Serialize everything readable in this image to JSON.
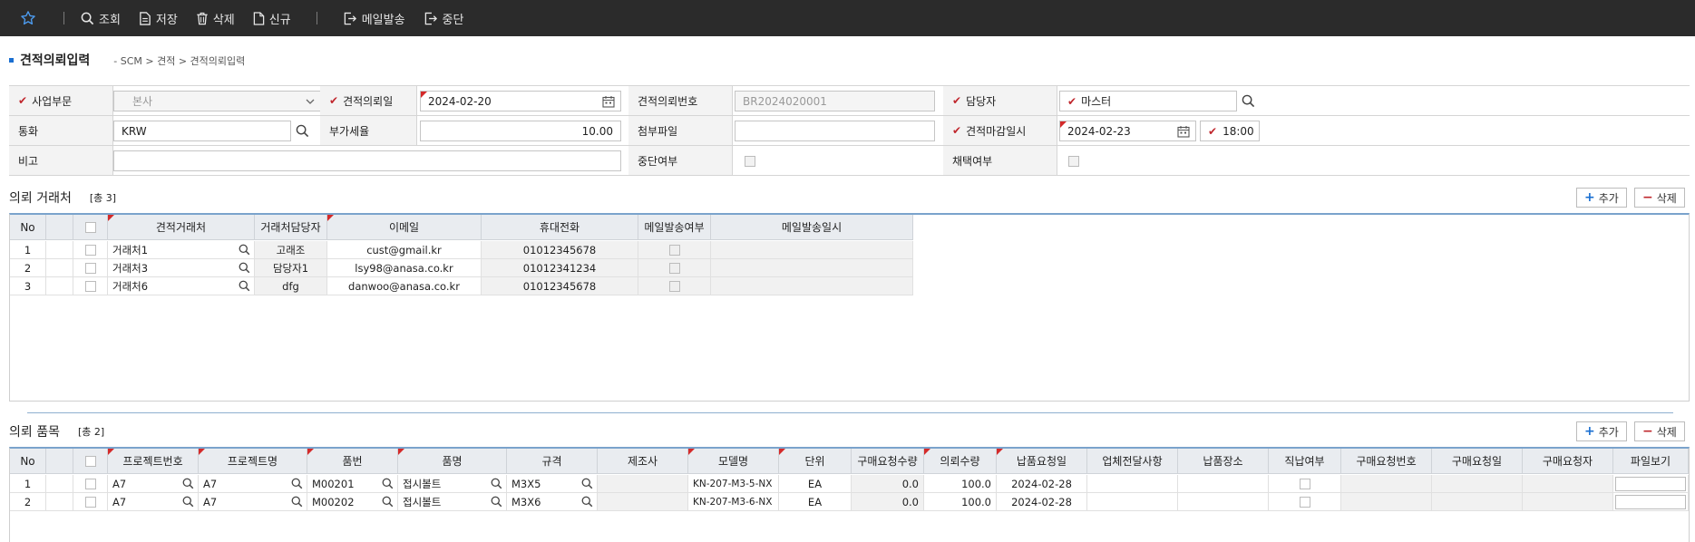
{
  "toolbar": {
    "favorite_icon": "star-icon",
    "buttons": {
      "search": "조회",
      "save": "저장",
      "delete": "삭제",
      "new": "신규",
      "send_mail": "메일발송",
      "stop": "중단"
    }
  },
  "header": {
    "title": "견적의뢰입력",
    "breadcrumb": "- SCM > 견적 > 견적의뢰입력"
  },
  "form": {
    "business_unit": {
      "label": "사업부문",
      "value": "본사"
    },
    "request_date": {
      "label": "견적의뢰일",
      "value": "2024-02-20"
    },
    "request_no": {
      "label": "견적의뢰번호",
      "value": "BR2024020001"
    },
    "manager": {
      "label": "담당자",
      "value": "마스터"
    },
    "currency": {
      "label": "통화",
      "value": "KRW"
    },
    "vat_rate": {
      "label": "부가세율",
      "value": "10.00"
    },
    "attachment": {
      "label": "첨부파일",
      "value": ""
    },
    "deadline": {
      "label": "견적마감일시",
      "date": "2024-02-23",
      "time": "18:00"
    },
    "remarks": {
      "label": "비고",
      "value": ""
    },
    "stop_flag": {
      "label": "중단여부"
    },
    "adopt_flag": {
      "label": "채택여부"
    }
  },
  "vendors": {
    "title": "의뢰 거래처",
    "count": "[총 3]",
    "add_label": "추가",
    "delete_label": "삭제",
    "columns": [
      "No",
      "견적거래처",
      "거래처담당자",
      "이메일",
      "휴대전화",
      "메일발송여부",
      "메일발송일시"
    ],
    "rows": [
      {
        "no": "1",
        "vendor": "거래처1",
        "contact": "고래조",
        "email": "cust@gmail.kr",
        "phone": "01012345678",
        "sent_at": ""
      },
      {
        "no": "2",
        "vendor": "거래처3",
        "contact": "담당자1",
        "email": "lsy98@anasa.co.kr",
        "phone": "01012341234",
        "sent_at": ""
      },
      {
        "no": "3",
        "vendor": "거래처6",
        "contact": "dfg",
        "email": "danwoo@anasa.co.kr",
        "phone": "01012345678",
        "sent_at": ""
      }
    ]
  },
  "items": {
    "title": "의뢰 품목",
    "count": "[총 2]",
    "add_label": "추가",
    "delete_label": "삭제",
    "columns": [
      "No",
      "프로젝트번호",
      "프로젝트명",
      "품번",
      "품명",
      "규격",
      "제조사",
      "모델명",
      "단위",
      "구매요청수량",
      "의뢰수량",
      "납품요청일",
      "업체전달사항",
      "납품장소",
      "직납여부",
      "구매요청번호",
      "구매요청일",
      "구매요청자",
      "파일보기"
    ],
    "rows": [
      {
        "no": "1",
        "project_no": "A7",
        "project_name": "A7",
        "part_no": "M00201",
        "part_name": "접시볼트",
        "spec": "M3X5",
        "maker": "",
        "model": "KN-207-M3-5-NX",
        "unit": "EA",
        "pr_qty": "0.0",
        "req_qty": "100.0",
        "due_date": "2024-02-28"
      },
      {
        "no": "2",
        "project_no": "A7",
        "project_name": "A7",
        "part_no": "M00202",
        "part_name": "접시볼트",
        "spec": "M3X6",
        "maker": "",
        "model": "KN-207-M3-6-NX",
        "unit": "EA",
        "pr_qty": "0.0",
        "req_qty": "100.0",
        "due_date": "2024-02-28"
      }
    ]
  }
}
